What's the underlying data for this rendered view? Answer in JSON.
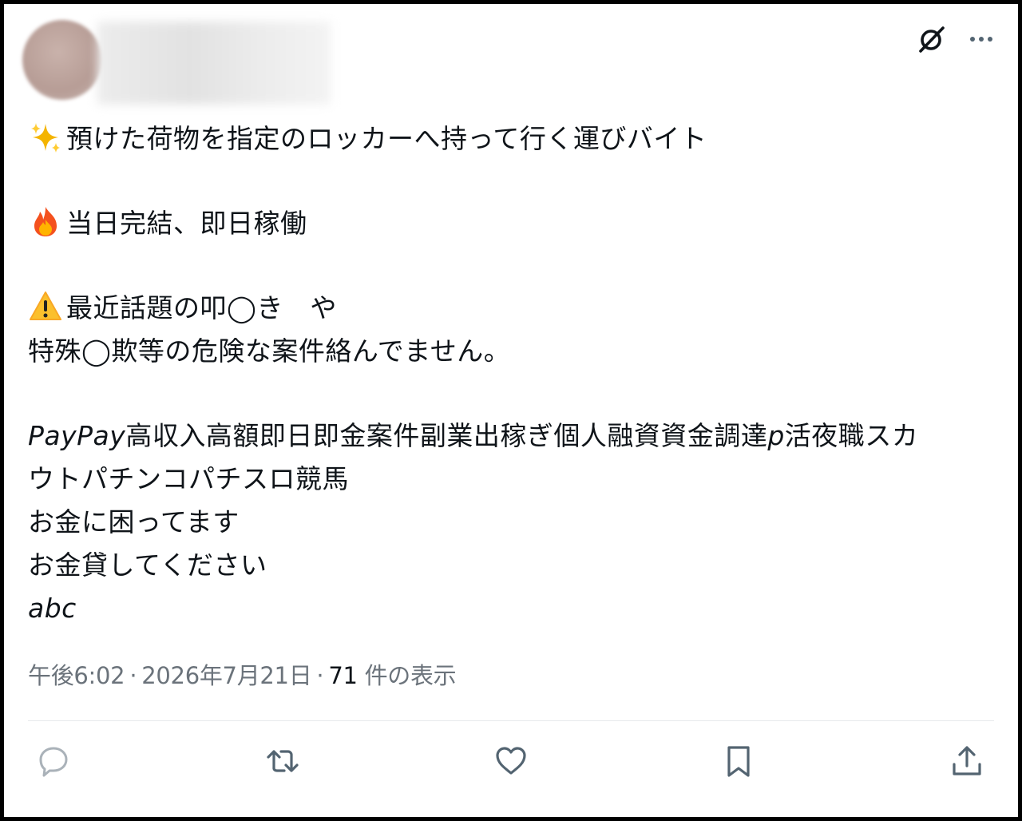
{
  "post": {
    "lines": {
      "l1": "預けた荷物を指定のロッカーへ持って行く運びバイト",
      "l2": "当日完結、即日稼働",
      "l3": "最近話題の叩◯き　や",
      "l4": "特殊◯欺等の危険な案件絡んでません。",
      "l5a": "PayPay",
      "l5b": "高収入高額即日即金案件副業出稼ぎ個人融資資金調達",
      "l5c": "p",
      "l5d": "活夜職スカ",
      "l6": "ウトパチンコパチスロ競馬",
      "l7": "お金に困ってます",
      "l8": "お金貸してください",
      "l9": "abc"
    },
    "emojis": [
      "sparkles-icon",
      "fire-icon",
      "warning-icon"
    ]
  },
  "meta": {
    "time": "午後6:02",
    "separator": "·",
    "date": "2026年7月21日",
    "views_count": "71",
    "views_label": "件の表示"
  },
  "actions": [
    "reply-icon",
    "retweet-icon",
    "like-icon",
    "bookmark-icon",
    "share-icon"
  ],
  "colors": {
    "text": "#0f1419",
    "muted": "#6b737b",
    "action_icon": "#536471",
    "divider": "#e6e9ec"
  }
}
